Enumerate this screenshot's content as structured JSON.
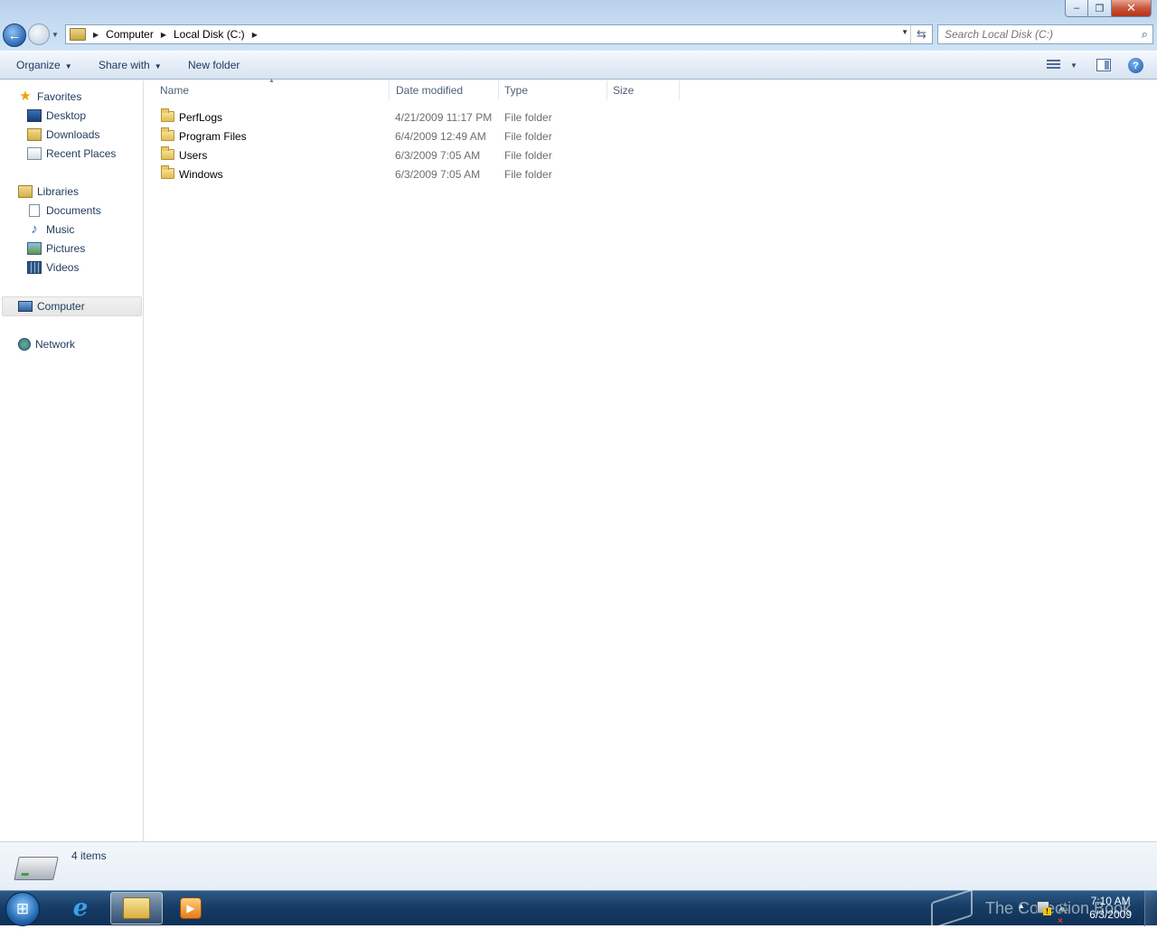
{
  "window": {
    "caption_buttons": {
      "minimize": "–",
      "maximize": "❐",
      "close": "✕"
    }
  },
  "address_bar": {
    "crumbs": [
      "Computer",
      "Local Disk (C:)"
    ],
    "refresh_symbol": "⇆"
  },
  "search": {
    "placeholder": "Search Local Disk (C:)"
  },
  "command_bar": {
    "organize": "Organize",
    "share_with": "Share with",
    "new_folder": "New folder",
    "help_symbol": "?"
  },
  "nav_pane": {
    "favorites": {
      "label": "Favorites",
      "items": [
        "Desktop",
        "Downloads",
        "Recent Places"
      ]
    },
    "libraries": {
      "label": "Libraries",
      "items": [
        "Documents",
        "Music",
        "Pictures",
        "Videos"
      ]
    },
    "computer": "Computer",
    "network": "Network"
  },
  "file_list": {
    "columns": [
      "Name",
      "Date modified",
      "Type",
      "Size"
    ],
    "rows": [
      {
        "name": "PerfLogs",
        "date": "4/21/2009 11:17 PM",
        "type": "File folder",
        "size": ""
      },
      {
        "name": "Program Files",
        "date": "6/4/2009 12:49 AM",
        "type": "File folder",
        "size": ""
      },
      {
        "name": "Users",
        "date": "6/3/2009 7:05 AM",
        "type": "File folder",
        "size": ""
      },
      {
        "name": "Windows",
        "date": "6/3/2009 7:05 AM",
        "type": "File folder",
        "size": ""
      }
    ]
  },
  "details": {
    "item_count": "4 items"
  },
  "taskbar": {
    "clock_time": "7:10 AM",
    "clock_date": "6/3/2009",
    "watermark": "The Collection Book"
  },
  "colors": {
    "taskbar": "#173d66",
    "link_text": "#1e395b",
    "muted_text": "#6d6d6d"
  }
}
